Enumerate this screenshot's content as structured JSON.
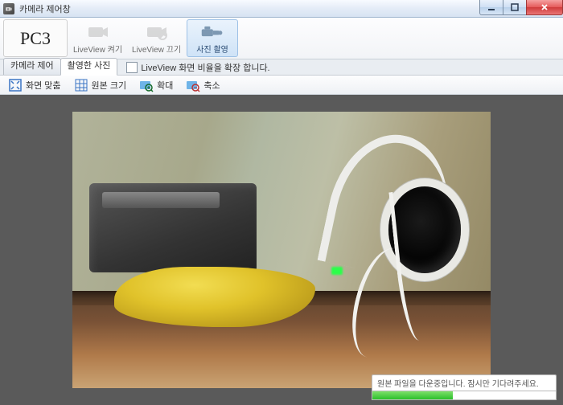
{
  "window": {
    "title": "카메라 제어창"
  },
  "ribbon": {
    "pc_label": "PC3",
    "liveview_on": "LiveView 켜기",
    "liveview_off": "LiveView 끄기",
    "shoot": "사진 촬영"
  },
  "tabs": {
    "camera_control": "카메라 제어",
    "captured_photo": "촬영한 사진",
    "expand_checkbox_label": "LiveView 화면 비율을 확장 합니다."
  },
  "toolbar": {
    "fit": "화면 맞춤",
    "original": "원본 크기",
    "zoom_in": "확대",
    "zoom_out": "축소"
  },
  "status": {
    "message": "원본 파일을 다운중입니다. 잠시만 기다려주세요.",
    "progress_percent": 44
  }
}
